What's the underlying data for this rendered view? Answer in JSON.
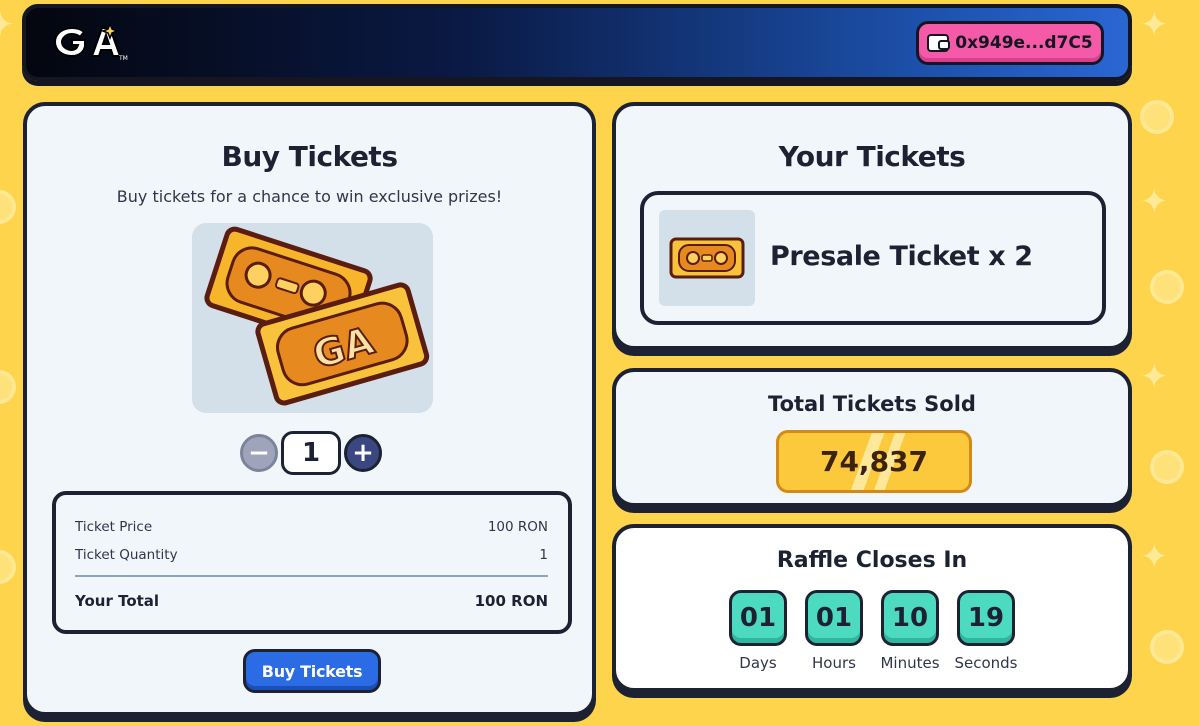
{
  "header": {
    "logo_text": "GA",
    "wallet_address": "0x949e...d7C5"
  },
  "buy": {
    "title": "Buy Tickets",
    "subtitle": "Buy tickets for a chance to win exclusive prizes!",
    "quantity": "1",
    "summary": {
      "price_label": "Ticket Price",
      "price_value": "100 RON",
      "quantity_label": "Ticket Quantity",
      "quantity_value": "1",
      "total_label": "Your Total",
      "total_value": "100 RON"
    },
    "button_label": "Buy Tickets"
  },
  "your_tickets": {
    "title": "Your Tickets",
    "item_label": "Presale Ticket x 2"
  },
  "sold": {
    "title": "Total Tickets Sold",
    "value": "74,837"
  },
  "raffle": {
    "title": "Raffle Closes In",
    "units": [
      {
        "value": "01",
        "label": "Days"
      },
      {
        "value": "01",
        "label": "Hours"
      },
      {
        "value": "10",
        "label": "Minutes"
      },
      {
        "value": "19",
        "label": "Seconds"
      }
    ]
  },
  "colors": {
    "background": "#fdd44b",
    "wallet": "#f45aa8",
    "primary_button": "#2b6be3",
    "countdown": "#4cdbc0",
    "sold_pill": "#fcc93d"
  }
}
